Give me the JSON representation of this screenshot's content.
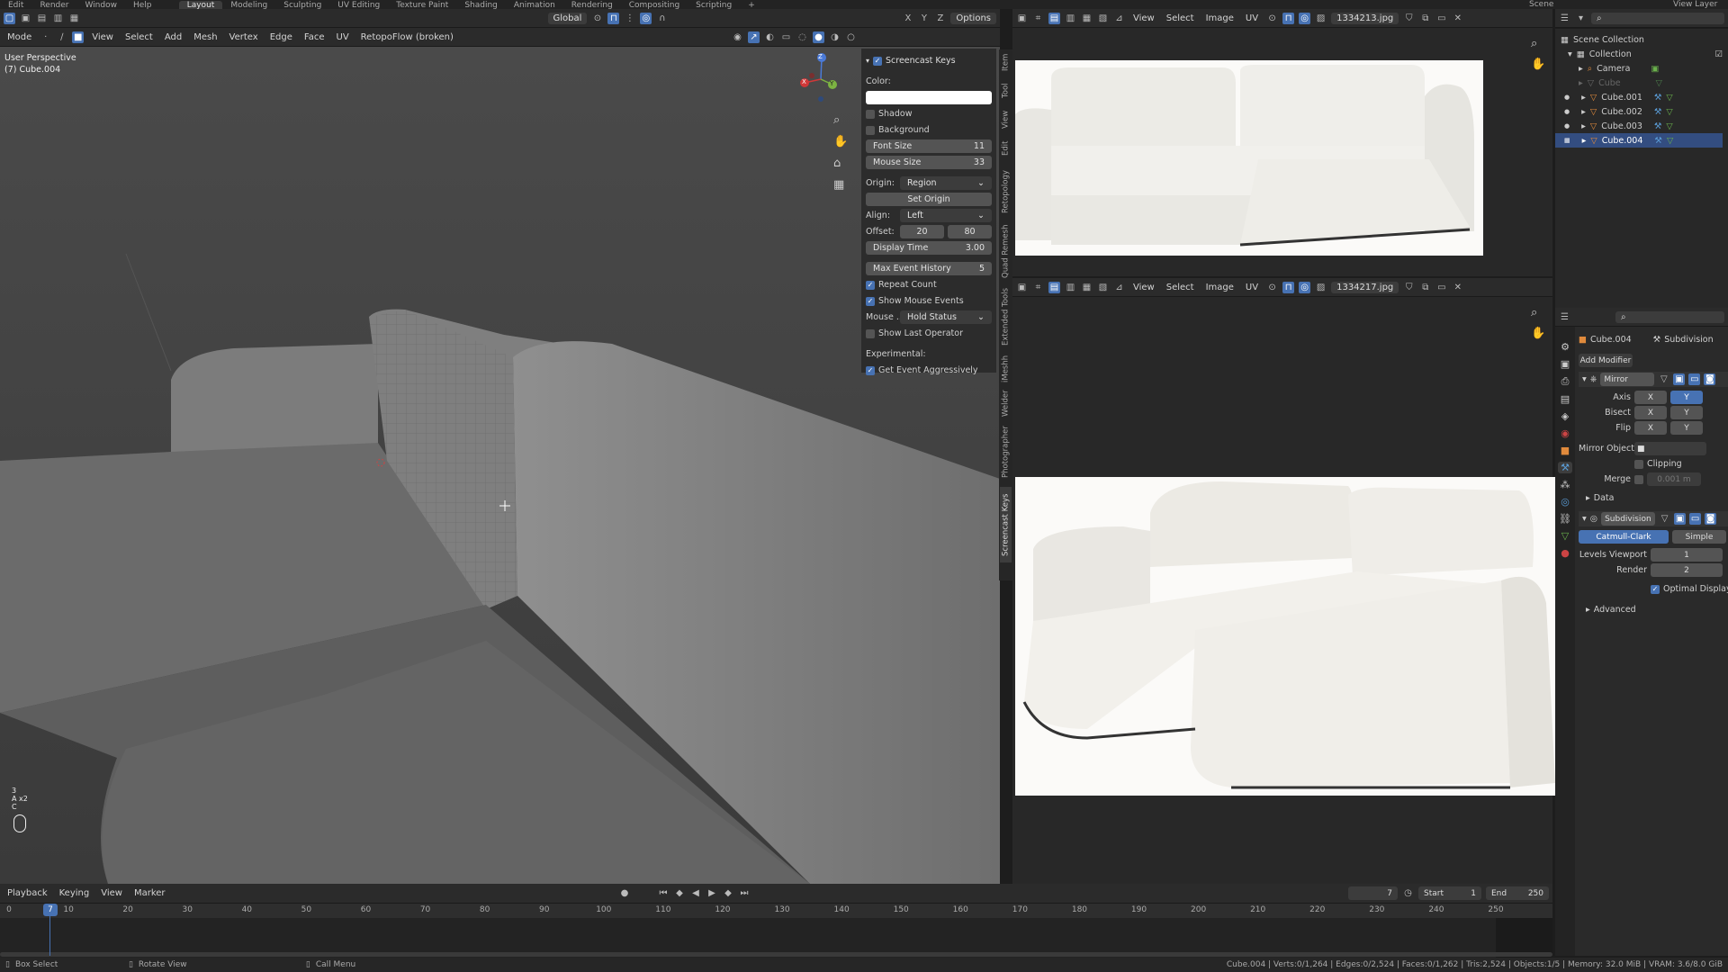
{
  "topbar": {
    "menus": [
      "Edit",
      "Render",
      "Window",
      "Help"
    ],
    "workspaces": [
      "Layout",
      "Modeling",
      "Sculpting",
      "UV Editing",
      "Texture Paint",
      "Shading",
      "Animation",
      "Rendering",
      "Compositing",
      "Scripting",
      "+"
    ],
    "scene": "Scene",
    "view_layer": "View Layer"
  },
  "viewport": {
    "mode": "Mode",
    "menus": [
      "View",
      "Select",
      "Add",
      "Mesh",
      "Vertex",
      "Edge",
      "Face",
      "UV"
    ],
    "retopoflow": "RetopoFlow (broken)",
    "orientation": "Global",
    "axes": [
      "X",
      "Y",
      "Z"
    ],
    "options": "Options",
    "overlay_title": "User Perspective",
    "overlay_object": "(7) Cube.004",
    "keys_lines": [
      "3",
      "A x2",
      "C"
    ],
    "gizmo": {
      "x": "X",
      "y": "Y",
      "z": "Z"
    }
  },
  "screencast": {
    "title": "Screencast Keys",
    "color_label": "Color:",
    "color_value": "#ffffff",
    "shadow": "Shadow",
    "background": "Background",
    "font_size_label": "Font Size",
    "font_size": "11",
    "mouse_size_label": "Mouse Size",
    "mouse_size": "33",
    "origin_label": "Origin:",
    "origin_value": "Region",
    "set_origin": "Set Origin",
    "align_label": "Align:",
    "align_value": "Left",
    "offset_label": "Offset:",
    "offset_x": "20",
    "offset_y": "80",
    "display_time_label": "Display Time",
    "display_time": "3.00",
    "max_history_label": "Max Event History",
    "max_history": "5",
    "repeat_count": "Repeat Count",
    "show_mouse_events": "Show Mouse Events",
    "mouse_label": "Mouse ...",
    "mouse_value": "Hold Status",
    "show_last_operator": "Show Last Operator",
    "experimental": "Experimental:",
    "get_event": "Get Event Aggressively"
  },
  "side_tabs": [
    "Item",
    "Tool",
    "View",
    "Edit",
    "Retopology",
    "Quad Remesh",
    "Extended Tools",
    "iMeshh",
    "Welder",
    "Photographer",
    "Screencast Keys"
  ],
  "image_editor_top": {
    "menus": [
      "View",
      "Select",
      "Image",
      "UV"
    ],
    "image": "1334213.jpg"
  },
  "image_editor_bottom": {
    "menus": [
      "View",
      "Select",
      "Image",
      "UV"
    ],
    "image": "1334217.jpg"
  },
  "outliner": {
    "root": "Scene Collection",
    "collection": "Collection",
    "items": [
      "Camera",
      "Cube",
      "Cube.001",
      "Cube.002",
      "Cube.003",
      "Cube.004"
    ]
  },
  "properties": {
    "object": "Cube.004",
    "modifier_tab": "Subdivision",
    "add_modifier": "Add Modifier",
    "mirror": {
      "name": "Mirror",
      "axis_label": "Axis",
      "bisect_label": "Bisect",
      "flip_label": "Flip",
      "x": "X",
      "y": "Y",
      "mirror_object_label": "Mirror Object",
      "clipping": "Clipping",
      "merge": "Merge",
      "merge_value": "0.001 m",
      "data": "Data"
    },
    "subdivision": {
      "name": "Subdivision",
      "catmull": "Catmull-Clark",
      "simple": "Simple",
      "levels_label": "Levels Viewport",
      "levels": "1",
      "render_label": "Render",
      "render": "2",
      "optimal": "Optimal Display",
      "advanced": "Advanced"
    }
  },
  "timeline": {
    "menus": [
      "Playback",
      "Keying",
      "View",
      "Marker"
    ],
    "current_frame": "7",
    "start_label": "Start",
    "start": "1",
    "end_label": "End",
    "end": "250",
    "ticks": [
      "0",
      "10",
      "20",
      "30",
      "40",
      "50",
      "60",
      "70",
      "80",
      "90",
      "100",
      "110",
      "120",
      "130",
      "140",
      "150",
      "160",
      "170",
      "180",
      "190",
      "200",
      "210",
      "220",
      "230",
      "240",
      "250"
    ]
  },
  "status": {
    "box_select": "Box Select",
    "rotate_view": "Rotate View",
    "call_menu": "Call Menu",
    "stats": "Cube.004 | Verts:0/1,264 | Edges:0/2,524 | Faces:0/1,262 | Tris:2,524 | Objects:1/5 | Memory: 32.0 MiB | VRAM: 3.6/8.0 GiB"
  }
}
